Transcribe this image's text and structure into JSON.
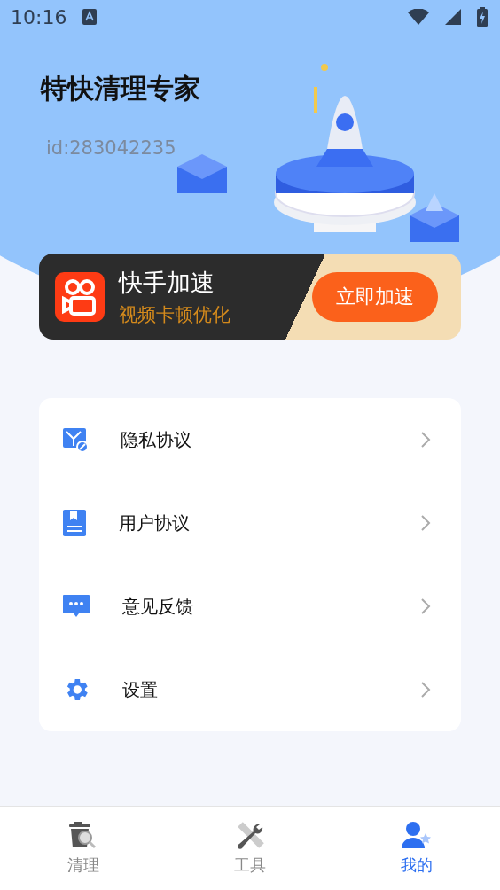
{
  "status_bar": {
    "time": "10:16"
  },
  "profile": {
    "app_name": "特快清理专家",
    "user_id": "id:283042235"
  },
  "promo": {
    "title": "快手加速",
    "subtitle": "视频卡顿优化",
    "button": "立即加速"
  },
  "menu": [
    {
      "kind": "privacy",
      "label": "隐私协议"
    },
    {
      "kind": "agreement",
      "label": "用户协议"
    },
    {
      "kind": "feedback",
      "label": "意见反馈"
    },
    {
      "kind": "settings",
      "label": "设置"
    }
  ],
  "tabs": [
    {
      "kind": "clean",
      "label": "清理",
      "selected": false
    },
    {
      "kind": "tools",
      "label": "工具",
      "selected": false
    },
    {
      "kind": "me",
      "label": "我的",
      "selected": true
    }
  ]
}
